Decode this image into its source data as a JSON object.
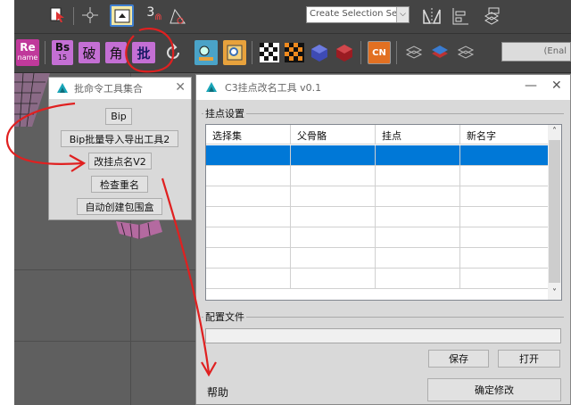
{
  "toolbar_top": {
    "selection_set_placeholder": "Create Selection Set",
    "dropdown_glyph": "⌵",
    "icons": [
      "select-window-icon",
      "pivot-icon",
      "snap-toggle-icon",
      "angle-snap-icon",
      "mirror-icon",
      "align-icon",
      "layer-manager-icon"
    ],
    "snap_label": "3"
  },
  "toolbar_plugins": {
    "buttons": [
      {
        "label": "Re",
        "sub": "name",
        "color": "#c0399b",
        "icon": "rename-plugin-icon"
      },
      {
        "label": "Bs",
        "sub": "15",
        "color": "#c46fd4",
        "icon": "bs-plugin-icon"
      },
      {
        "label": "破",
        "color": "#c46fd4",
        "icon": "break-plugin-icon"
      },
      {
        "label": "角",
        "color": "#c46fd4",
        "icon": "angle-plugin-icon"
      },
      {
        "label": "批",
        "color": "#c46fd4",
        "icon": "batch-plugin-icon"
      }
    ],
    "cn_label": "CN",
    "enable_text": "(Enal"
  },
  "batch_dialog": {
    "title": "批命令工具集合",
    "close_glyph": "✕",
    "buttons": [
      "Bip",
      "Bip批量导入导出工具2",
      "改挂点名V2",
      "检查重名",
      "自动创建包围盒"
    ]
  },
  "main_window": {
    "title": "C3挂点改名工具 v0.1",
    "minimize_glyph": "—",
    "close_glyph": "✕",
    "group_hardpoints": "挂点设置",
    "columns": [
      "选择集",
      "父骨骼",
      "挂点",
      "新名字"
    ],
    "rows": [
      [
        "",
        "",
        "",
        ""
      ],
      [
        "",
        "",
        "",
        ""
      ],
      [
        "",
        "",
        "",
        ""
      ],
      [
        "",
        "",
        "",
        ""
      ],
      [
        "",
        "",
        "",
        ""
      ],
      [
        "",
        "",
        "",
        ""
      ],
      [
        "",
        "",
        "",
        ""
      ]
    ],
    "selected_row": 0,
    "scroll_up": "˄",
    "scroll_down": "˅",
    "group_config": "配置文件",
    "config_path": "",
    "save_label": "保存",
    "open_label": "打开",
    "help_label": "帮助",
    "confirm_label": "确定修改"
  },
  "colors": {
    "selection": "#0078d7",
    "annotation": "#e02020",
    "plugin_pink": "#c46fd4"
  }
}
